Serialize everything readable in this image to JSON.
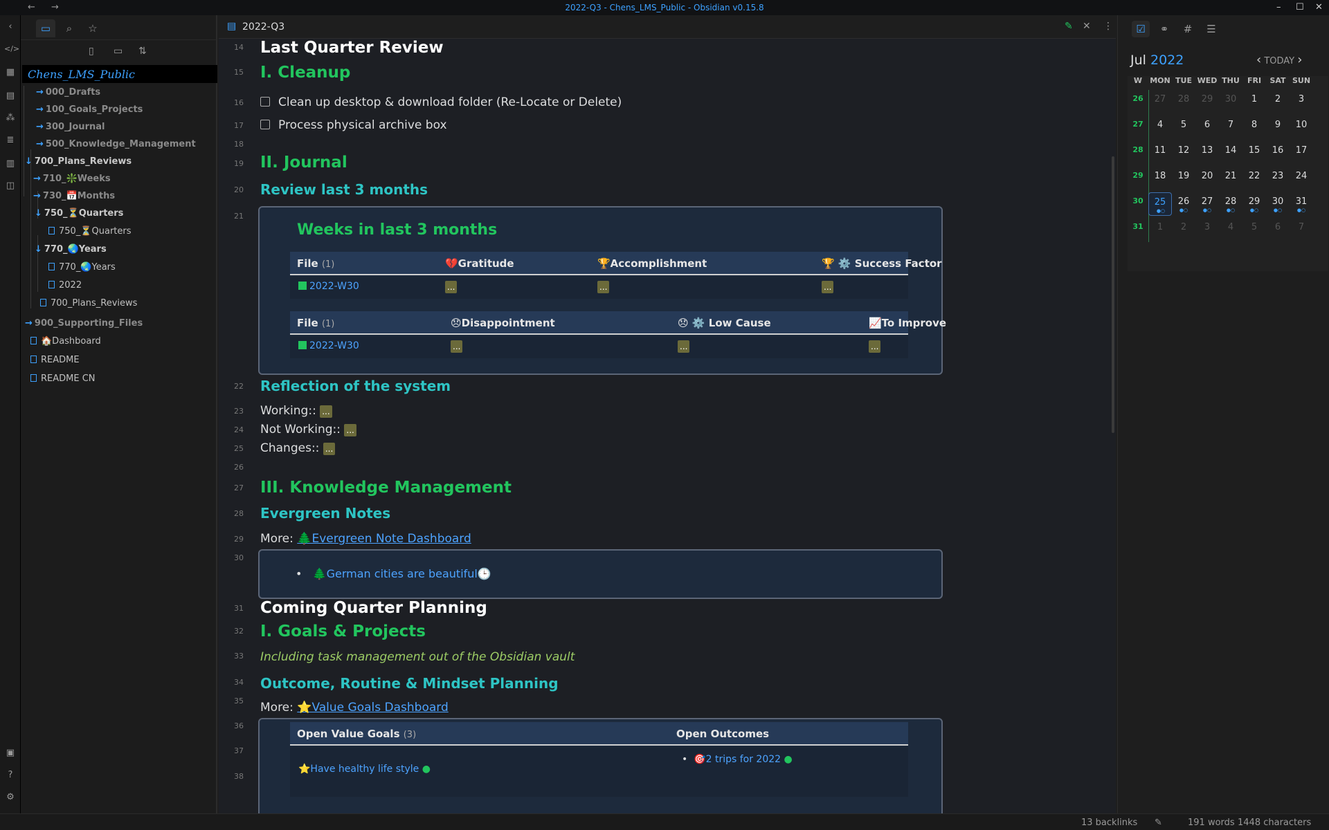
{
  "window": {
    "title": "2022-Q3 - Chens_LMS_Public - Obsidian v0.15.8",
    "back": "←",
    "forward": "→",
    "minimize": "–",
    "maximize": "☐",
    "close": "✕"
  },
  "sidebar": {
    "vault_name": "Chens_LMS_Public",
    "tree": [
      {
        "label": "000_Drafts"
      },
      {
        "label": "100_Goals_Projects"
      },
      {
        "label": "300_Journal"
      },
      {
        "label": "500_Knowledge_Management"
      },
      {
        "label": "700_Plans_Reviews"
      },
      {
        "label": "710_❇️Weeks"
      },
      {
        "label": "730_📅Months"
      },
      {
        "label": "750_⏳Quarters"
      },
      {
        "label": "750_⏳Quarters"
      },
      {
        "label": "770_🌏Years"
      },
      {
        "label": "770_🌏Years"
      },
      {
        "label": "2022"
      },
      {
        "label": "700_Plans_Reviews"
      },
      {
        "label": "900_Supporting_Files"
      },
      {
        "label": "🏠Dashboard"
      },
      {
        "label": "README"
      },
      {
        "label": "README CN"
      }
    ]
  },
  "editor": {
    "tab_title": "2022-Q3",
    "line_numbers": [
      "14",
      "15",
      "16",
      "17",
      "18",
      "19",
      "20",
      "21",
      "22",
      "23",
      "24",
      "25",
      "26",
      "27",
      "28",
      "29",
      "30",
      "31",
      "32",
      "33",
      "34",
      "35",
      "36",
      "37",
      "38"
    ],
    "last_quarter_review": "Last Quarter Review",
    "cleanup_heading": "I. Cleanup",
    "task1": "Clean up desktop & download folder (Re-Locate or Delete)",
    "task2": "Process physical archive box",
    "journal_heading": "II. Journal",
    "review_heading": "Review last 3 months",
    "weeks_box_title": "Weeks in last 3 months",
    "table1": {
      "headers": [
        "File",
        "💔Gratitude",
        "🏆Accomplishment",
        "🏆 ⚙️ Success Factor"
      ],
      "count": "(1)",
      "row": [
        "2022-W30",
        "...",
        "...",
        "..."
      ]
    },
    "table2": {
      "headers": [
        "File",
        "😞Disappointment",
        "😞 ⚙️ Low Cause",
        "📈To Improve"
      ],
      "count": "(1)",
      "row": [
        "2022-W30",
        "...",
        "...",
        "..."
      ]
    },
    "reflection_heading": "Reflection of the system",
    "working_label": "Working::",
    "not_working_label": "Not Working::",
    "changes_label": "Changes::",
    "ellipsis": "...",
    "km_heading": "III. Knowledge Management",
    "evergreen_heading": "Evergreen Notes",
    "more_label": "More:",
    "evergreen_link": "🌲Evergreen Note Dashboard",
    "evergreen_item": "🌲German cities are beautiful",
    "evergreen_item_icon": "🕒",
    "coming_heading": "Coming Quarter Planning",
    "goals_heading": "I. Goals & Projects",
    "goals_note": "Including task management out of the Obsidian vault",
    "outcome_heading": "Outcome, Routine & Mindset Planning",
    "value_goals_link": "⭐Value Goals Dashboard",
    "table3": {
      "headers": [
        "Open Value Goals",
        "Open Outcomes"
      ],
      "count": "(3)",
      "goal": "⭐Have healthy life style",
      "outcome": "🎯2 trips for 2022"
    }
  },
  "calendar": {
    "month": "Jul",
    "year": "2022",
    "today_label": "TODAY",
    "headers": [
      "W",
      "MON",
      "TUE",
      "WED",
      "THU",
      "FRI",
      "SAT",
      "SUN"
    ],
    "weeks": [
      {
        "w": "26",
        "days": [
          "27",
          "28",
          "29",
          "30",
          "1",
          "2",
          "3"
        ]
      },
      {
        "w": "27",
        "days": [
          "4",
          "5",
          "6",
          "7",
          "8",
          "9",
          "10"
        ]
      },
      {
        "w": "28",
        "days": [
          "11",
          "12",
          "13",
          "14",
          "15",
          "16",
          "17"
        ]
      },
      {
        "w": "29",
        "days": [
          "18",
          "19",
          "20",
          "21",
          "22",
          "23",
          "24"
        ]
      },
      {
        "w": "30",
        "days": [
          "25",
          "26",
          "27",
          "28",
          "29",
          "30",
          "31"
        ]
      },
      {
        "w": "31",
        "days": [
          "1",
          "2",
          "3",
          "4",
          "5",
          "6",
          "7"
        ]
      }
    ]
  },
  "status": {
    "backlinks": "13 backlinks",
    "words": "191 words",
    "characters": "1448 characters"
  }
}
